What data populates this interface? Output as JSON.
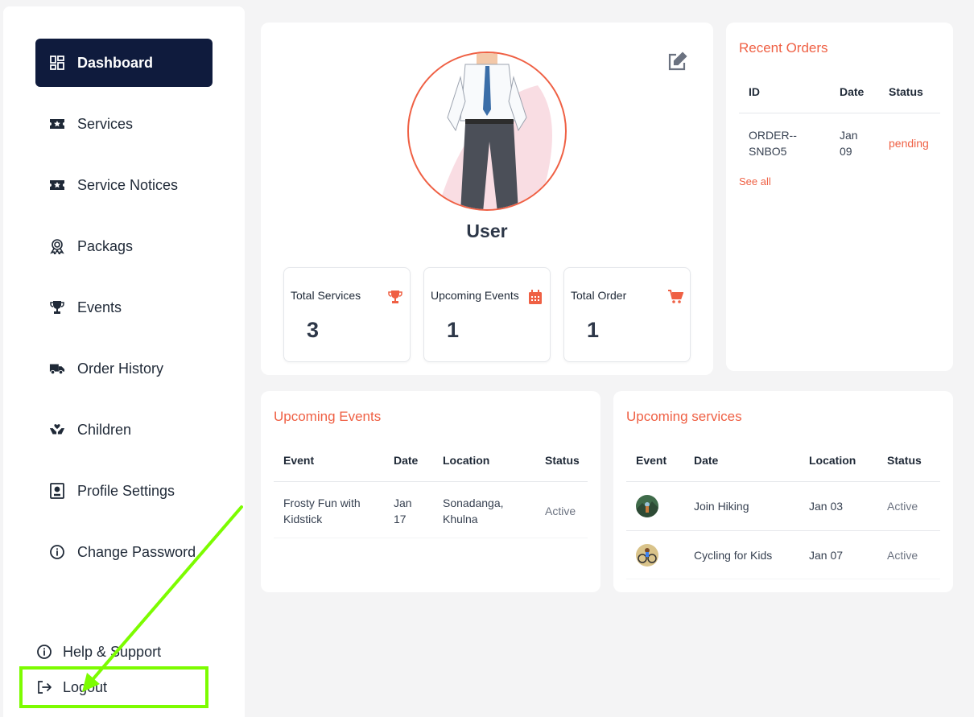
{
  "sidebar": {
    "items": [
      {
        "label": "Dashboard",
        "icon": "dashboard-icon",
        "active": true
      },
      {
        "label": "Services",
        "icon": "ticket-star-icon"
      },
      {
        "label": "Service Notices",
        "icon": "ticket-star-icon"
      },
      {
        "label": "Packags",
        "icon": "award-ribbon-icon"
      },
      {
        "label": "Events",
        "icon": "trophy-icon"
      },
      {
        "label": "Order History",
        "icon": "truck-icon"
      },
      {
        "label": "Children",
        "icon": "hands-heart-icon"
      },
      {
        "label": "Profile Settings",
        "icon": "profile-card-icon"
      },
      {
        "label": "Change Password",
        "icon": "info-circle-icon"
      }
    ],
    "help_label": "Help & Support",
    "logout_label": "Logout"
  },
  "profile": {
    "name": "User",
    "stats": [
      {
        "label": "Total Services",
        "value": "3",
        "icon": "trophy-icon"
      },
      {
        "label": "Upcoming Events",
        "value": "1",
        "icon": "calendar-icon"
      },
      {
        "label": "Total Order",
        "value": "1",
        "icon": "cart-icon"
      }
    ]
  },
  "recent_orders": {
    "title": "Recent Orders",
    "columns": [
      "ID",
      "Date",
      "Status"
    ],
    "rows": [
      {
        "id_line1": "ORDER--",
        "id_line2": "SNBO5",
        "date_line1": "Jan",
        "date_line2": "09",
        "status": "pending"
      }
    ],
    "see_all": "See all"
  },
  "upcoming_events": {
    "title": "Upcoming Events",
    "columns": [
      "Event",
      "Date",
      "Location",
      "Status"
    ],
    "rows": [
      {
        "event_line1": "Frosty Fun with",
        "event_line2": "Kidstick",
        "date_line1": "Jan",
        "date_line2": "17",
        "loc_line1": "Sonadanga,",
        "loc_line2": "Khulna",
        "status": "Active"
      }
    ]
  },
  "upcoming_services": {
    "title": "Upcoming services",
    "columns": [
      "Event",
      "Date",
      "Location",
      "Status"
    ],
    "rows": [
      {
        "name": "Join Hiking",
        "date": "Jan 03",
        "status": "Active"
      },
      {
        "name": "Cycling for Kids",
        "date": "Jan 07",
        "status": "Active"
      }
    ]
  },
  "colors": {
    "accent": "#ef6044",
    "nav_active": "#0f1b3d",
    "annotation": "#7cfc00"
  }
}
